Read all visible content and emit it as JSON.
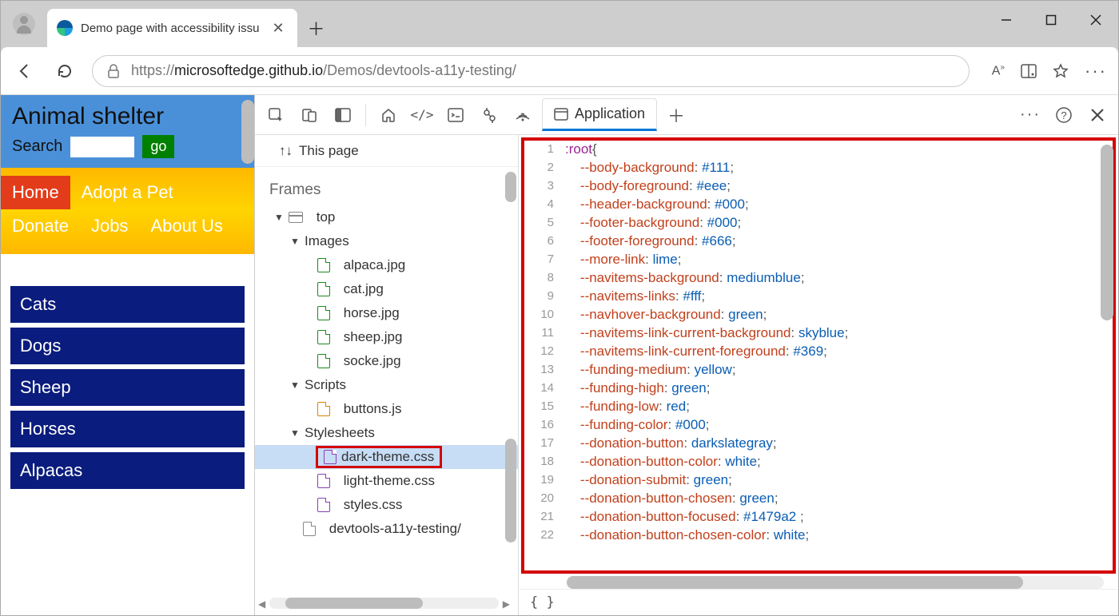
{
  "browser": {
    "tab_title": "Demo page with accessibility issu",
    "url_prefix": "https://",
    "url_host": "microsoftedge.github.io",
    "url_path": "/Demos/devtools-a11y-testing/"
  },
  "demo": {
    "title": "Animal shelter",
    "search_label": "Search",
    "go_label": "go",
    "nav": [
      "Home",
      "Adopt a Pet",
      "Donate",
      "Jobs",
      "About Us"
    ],
    "categories": [
      "Cats",
      "Dogs",
      "Sheep",
      "Horses",
      "Alpacas"
    ]
  },
  "devtools": {
    "active_tab": "Application",
    "this_page_label": "This page",
    "frames_label": "Frames",
    "tree": {
      "top": "top",
      "images_label": "Images",
      "images": [
        "alpaca.jpg",
        "cat.jpg",
        "horse.jpg",
        "sheep.jpg",
        "socke.jpg"
      ],
      "scripts_label": "Scripts",
      "scripts": [
        "buttons.js"
      ],
      "stylesheets_label": "Stylesheets",
      "stylesheets": [
        "dark-theme.css",
        "light-theme.css",
        "styles.css"
      ],
      "selected": "dark-theme.css",
      "root_file": "devtools-a11y-testing/"
    },
    "braces": "{ }",
    "code": [
      {
        "n": 1,
        "sel": ":root",
        "punc": "{"
      },
      {
        "n": 2,
        "prop": "--body-background",
        "val": "#111"
      },
      {
        "n": 3,
        "prop": "--body-foreground",
        "val": "#eee"
      },
      {
        "n": 4,
        "prop": "--header-background",
        "val": "#000"
      },
      {
        "n": 5,
        "prop": "--footer-background",
        "val": "#000"
      },
      {
        "n": 6,
        "prop": "--footer-foreground",
        "val": "#666"
      },
      {
        "n": 7,
        "prop": "--more-link",
        "val": "lime"
      },
      {
        "n": 8,
        "prop": "--navitems-background",
        "val": "mediumblue"
      },
      {
        "n": 9,
        "prop": "--navitems-links",
        "val": "#fff"
      },
      {
        "n": 10,
        "prop": "--navhover-background",
        "val": "green"
      },
      {
        "n": 11,
        "prop": "--navitems-link-current-background",
        "val": "skyblue"
      },
      {
        "n": 12,
        "prop": "--navitems-link-current-foreground",
        "val": "#369"
      },
      {
        "n": 13,
        "prop": "--funding-medium",
        "val": "yellow"
      },
      {
        "n": 14,
        "prop": "--funding-high",
        "val": "green"
      },
      {
        "n": 15,
        "prop": "--funding-low",
        "val": "red"
      },
      {
        "n": 16,
        "prop": "--funding-color",
        "val": "#000"
      },
      {
        "n": 17,
        "prop": "--donation-button",
        "val": "darkslategray"
      },
      {
        "n": 18,
        "prop": "--donation-button-color",
        "val": "white"
      },
      {
        "n": 19,
        "prop": "--donation-submit",
        "val": "green"
      },
      {
        "n": 20,
        "prop": "--donation-button-chosen",
        "val": "green"
      },
      {
        "n": 21,
        "prop": "--donation-button-focused",
        "val": "#1479a2 "
      },
      {
        "n": 22,
        "prop": "--donation-button-chosen-color",
        "val": "white"
      }
    ]
  }
}
